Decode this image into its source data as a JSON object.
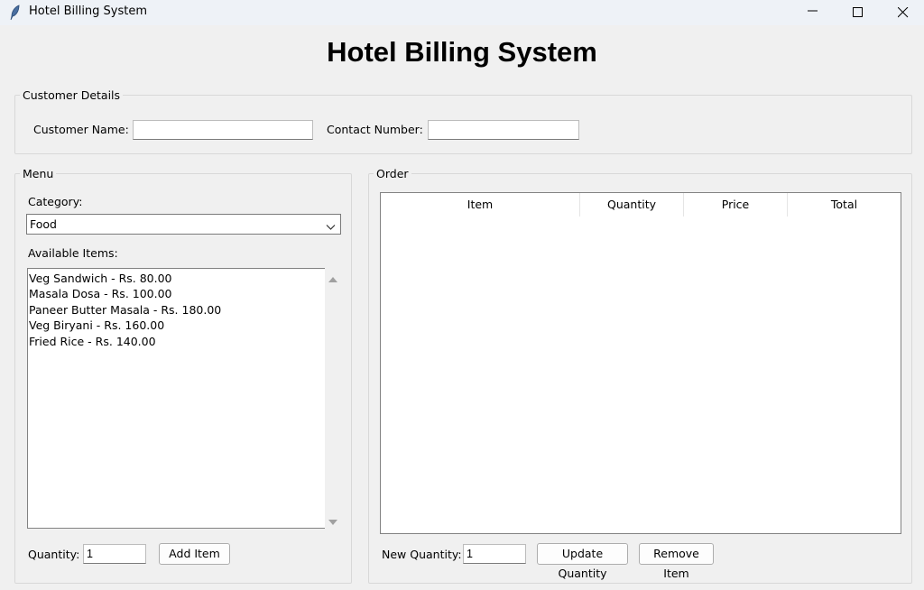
{
  "window": {
    "title": "Hotel Billing System",
    "app_icon": "feather-icon"
  },
  "header": {
    "title": "Hotel Billing System"
  },
  "customer_details": {
    "frame_label": "Customer Details",
    "name_label": "Customer Name:",
    "name_value": "",
    "contact_label": "Contact Number:",
    "contact_value": ""
  },
  "menu": {
    "frame_label": "Menu",
    "category_label": "Category:",
    "category_value": "Food",
    "available_label": "Available Items:",
    "items": [
      "Veg Sandwich - Rs. 80.00",
      "Masala Dosa - Rs. 100.00",
      "Paneer Butter Masala - Rs. 180.00",
      "Veg Biryani - Rs. 160.00",
      "Fried Rice - Rs. 140.00"
    ],
    "quantity_label": "Quantity:",
    "quantity_value": "1",
    "add_button": "Add Item"
  },
  "order": {
    "frame_label": "Order",
    "columns": [
      "Item",
      "Quantity",
      "Price",
      "Total"
    ],
    "rows": [],
    "new_quantity_label": "New Quantity:",
    "new_quantity_value": "1",
    "update_button": "Update Quantity",
    "remove_button": "Remove Item"
  }
}
